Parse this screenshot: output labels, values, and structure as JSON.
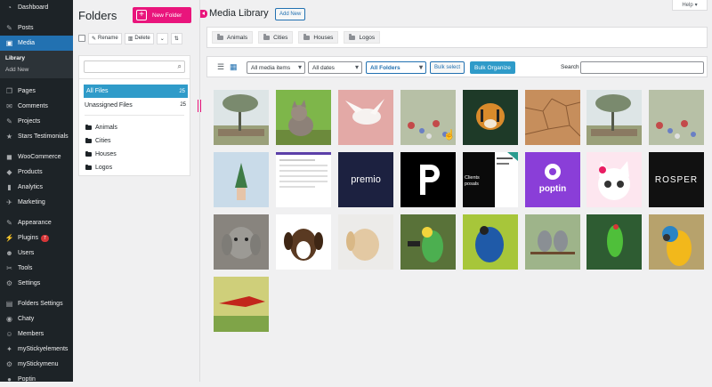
{
  "sidebar": {
    "items": [
      {
        "label": "Dashboard",
        "icon": "dashboard-icon",
        "glyph": "◔"
      },
      {
        "label": "Posts",
        "icon": "pin-icon",
        "glyph": "✎"
      },
      {
        "label": "Media",
        "icon": "media-icon",
        "glyph": "▣",
        "active": true
      },
      {
        "label": "Pages",
        "icon": "pages-icon",
        "glyph": "❐"
      },
      {
        "label": "Comments",
        "icon": "comments-icon",
        "glyph": "✉"
      },
      {
        "label": "Projects",
        "icon": "projects-icon",
        "glyph": "✎"
      },
      {
        "label": "Stars Testimonials",
        "icon": "testimonials-icon",
        "glyph": "★"
      },
      {
        "label": "WooCommerce",
        "icon": "woocommerce-icon",
        "glyph": "◼"
      },
      {
        "label": "Products",
        "icon": "products-icon",
        "glyph": "◆"
      },
      {
        "label": "Analytics",
        "icon": "analytics-icon",
        "glyph": "▮"
      },
      {
        "label": "Marketing",
        "icon": "marketing-icon",
        "glyph": "✈"
      },
      {
        "label": "Appearance",
        "icon": "appearance-icon",
        "glyph": "✎"
      },
      {
        "label": "Plugins",
        "icon": "plugins-icon",
        "glyph": "⚡",
        "badge": "7"
      },
      {
        "label": "Users",
        "icon": "users-icon",
        "glyph": "☻"
      },
      {
        "label": "Tools",
        "icon": "tools-icon",
        "glyph": "✂"
      },
      {
        "label": "Settings",
        "icon": "settings-icon",
        "glyph": "⚙"
      },
      {
        "label": "Folders Settings",
        "icon": "folders-settings-icon",
        "glyph": "▤"
      },
      {
        "label": "Chaty",
        "icon": "chaty-icon",
        "glyph": "◉"
      },
      {
        "label": "Members",
        "icon": "members-icon",
        "glyph": "☺"
      },
      {
        "label": "myStickyelements",
        "icon": "mystickyelements-icon",
        "glyph": "✦"
      },
      {
        "label": "myStickymenu",
        "icon": "mystickymenu-icon",
        "glyph": "⚙"
      },
      {
        "label": "Poptin",
        "icon": "poptin-icon",
        "glyph": "●"
      }
    ],
    "media_sub": {
      "library": "Library",
      "add_new": "Add New"
    }
  },
  "folders": {
    "title": "Folders",
    "new_folder": "New Folder",
    "rename": "Rename",
    "delete": "Delete",
    "all_files": "All Files",
    "all_files_count": "25",
    "unassigned": "Unassigned Files",
    "unassigned_count": "25",
    "list": [
      "Animals",
      "Cities",
      "Houses",
      "Logos"
    ]
  },
  "main": {
    "title": "Media Library",
    "add_new": "Add New",
    "help": "Help",
    "chips": [
      "Animals",
      "Cities",
      "Houses",
      "Logos"
    ],
    "filter_type": "All media items",
    "filter_date": "All dates",
    "filter_folder": "All Folders",
    "bulk_select": "Bulk select",
    "bulk_organize": "Bulk Organize",
    "search_label": "Search",
    "logo_premio": "premio",
    "logo_poptin": "poptin",
    "logo_rosper": "ROSPER",
    "logo_clients": "Clients posals"
  },
  "colors": {
    "accent": "#2271b1",
    "brand_pink": "#e9157c",
    "sidebar_bg": "#1d2327",
    "selected": "#2f9bc9"
  }
}
